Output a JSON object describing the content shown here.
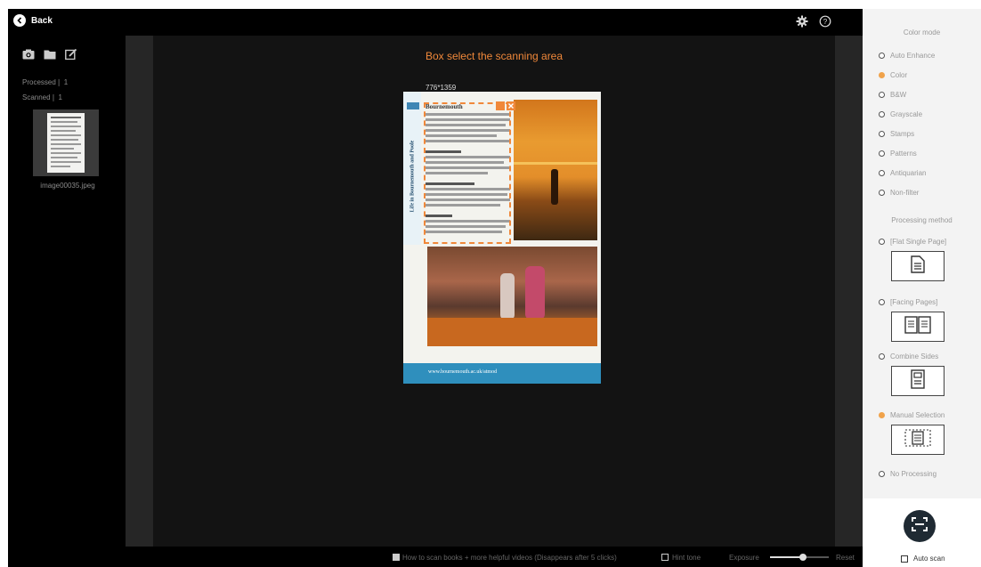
{
  "topbar": {
    "back_label": "Back"
  },
  "left": {
    "processed_label": "Processed❘ 1",
    "scanned_label": "Scanned❘ 1",
    "thumbnail_name": "image00035.jpeg"
  },
  "camera": {
    "hint_title": "Box select the scanning area",
    "dimensions": "776*1359",
    "doc": {
      "title": "Bournemouth",
      "side_text": "Life in Bournemouth and Poole",
      "url": "www.bournemouth.ac.uk/atmod"
    }
  },
  "bottom": {
    "video_text": "How to scan books + more helpful videos (Disappears after 5 clicks)",
    "hint_tone_label": "Hint tone",
    "exposure_label": "Exposure",
    "reset_label": "Reset"
  },
  "right": {
    "color_mode_header": "Color mode",
    "color_modes": [
      {
        "label": "Auto Enhance",
        "selected": false
      },
      {
        "label": "Color",
        "selected": true
      },
      {
        "label": "B&W",
        "selected": false
      },
      {
        "label": "Grayscale",
        "selected": false
      },
      {
        "label": "Stamps",
        "selected": false
      },
      {
        "label": "Patterns",
        "selected": false
      },
      {
        "label": "Antiquarian",
        "selected": false
      },
      {
        "label": "Non-filter",
        "selected": false
      }
    ],
    "processing_header": "Processing method",
    "processing": [
      {
        "label": "[Flat Single Page]",
        "selected": false,
        "icon": "page-icon"
      },
      {
        "label": "[Facing Pages]",
        "selected": false,
        "icon": "book-icon"
      },
      {
        "label": "Combine Sides",
        "selected": false,
        "icon": "id-card-icon"
      },
      {
        "label": "Manual Selection",
        "selected": true,
        "icon": "selection-icon"
      },
      {
        "label": "No Processing",
        "selected": false
      }
    ],
    "auto_scan_label": "Auto scan"
  },
  "colors": {
    "accent": "#f0883a",
    "selected_radio": "#f0a24a"
  }
}
